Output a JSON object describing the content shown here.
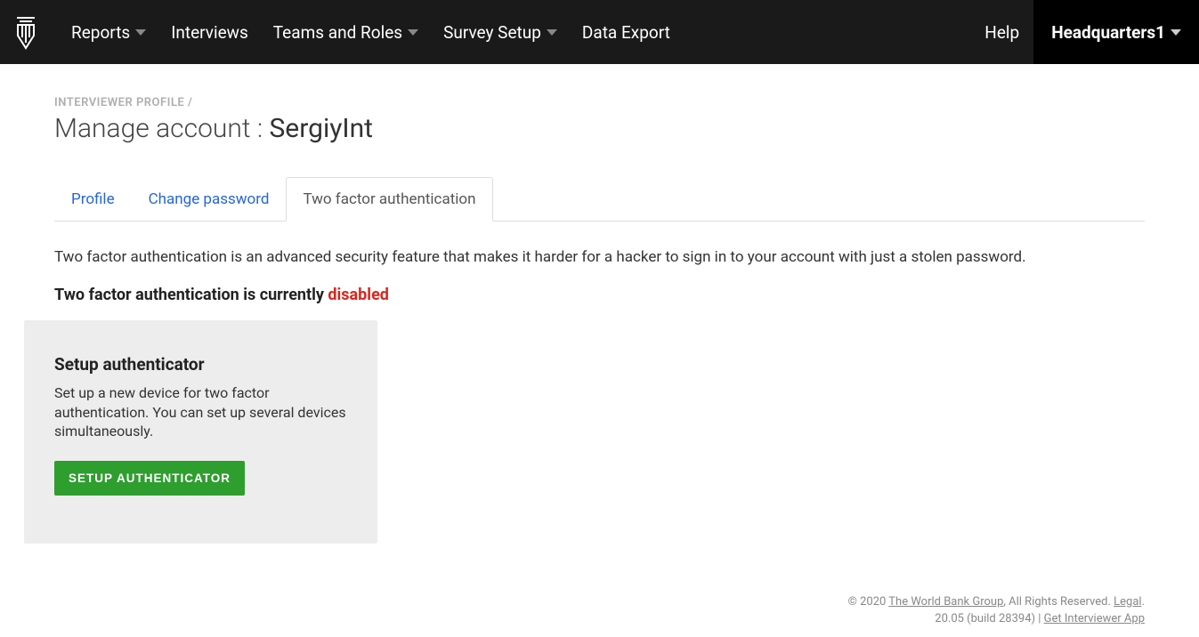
{
  "nav": {
    "items": [
      {
        "label": "Reports",
        "hasDropdown": true
      },
      {
        "label": "Interviews",
        "hasDropdown": false
      },
      {
        "label": "Teams and Roles",
        "hasDropdown": true
      },
      {
        "label": "Survey Setup",
        "hasDropdown": true
      },
      {
        "label": "Data Export",
        "hasDropdown": false
      }
    ],
    "help": "Help",
    "account": "Headquarters1"
  },
  "breadcrumb": "INTERVIEWER PROFILE /",
  "page_title_prefix": "Manage account : ",
  "username": "SergiyInt",
  "tabs": [
    {
      "label": "Profile",
      "active": false
    },
    {
      "label": "Change password",
      "active": false
    },
    {
      "label": "Two factor authentication",
      "active": true
    }
  ],
  "description": "Two factor authentication is an advanced security feature that makes it harder for a hacker to sign in to your account with just a stolen password.",
  "status_prefix": "Two factor authentication is currently ",
  "status_value": "disabled",
  "card": {
    "title": "Setup authenticator",
    "body": "Set up a new device for two factor authentication. You can set up several devices simultaneously.",
    "button": "SETUP AUTHENTICATOR"
  },
  "footer": {
    "copyright_prefix": "© 2020 ",
    "org": "The World Bank Group",
    "rights": ", All Rights Reserved. ",
    "legal": "Legal",
    "version": "20.05 (build 28394) | ",
    "app_link": "Get Interviewer App"
  }
}
